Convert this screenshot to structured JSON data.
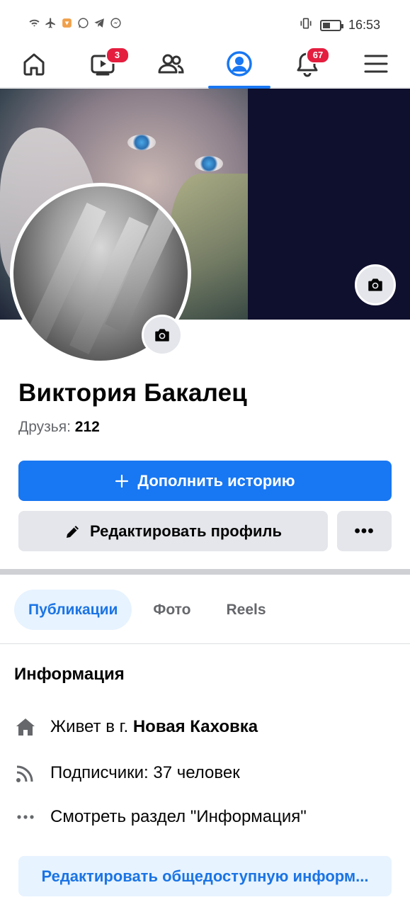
{
  "status_bar": {
    "time": "16:53",
    "left_icons": [
      "wifi-icon",
      "airplane-icon",
      "shield-icon",
      "whatsapp-icon",
      "telegram-icon",
      "messenger-icon"
    ],
    "right_icons": [
      "vibrate-icon",
      "battery-icon"
    ]
  },
  "nav": {
    "items": [
      {
        "name": "home",
        "icon": "home-icon"
      },
      {
        "name": "video",
        "icon": "video-icon",
        "badge": "3"
      },
      {
        "name": "friends",
        "icon": "friends-icon"
      },
      {
        "name": "profile",
        "icon": "profile-icon",
        "active": true
      },
      {
        "name": "notifications",
        "icon": "bell-icon",
        "badge": "67"
      },
      {
        "name": "menu",
        "icon": "menu-icon"
      }
    ]
  },
  "profile": {
    "name": "Виктория Бакалец",
    "friends_label": "Друзья:",
    "friends_count": "212"
  },
  "buttons": {
    "add_story": "Дополнить историю",
    "edit_profile": "Редактировать профиль",
    "more": "•••"
  },
  "tabs": [
    {
      "label": "Публикации",
      "active": true
    },
    {
      "label": "Фото",
      "active": false
    },
    {
      "label": "Reels",
      "active": false
    }
  ],
  "info": {
    "title": "Информация",
    "lives_prefix": "Живет в г.",
    "lives_city": "Новая Каховка",
    "followers": "Подписчики: 37 человек",
    "see_more": "Смотреть раздел \"Информация\"",
    "edit_public": "Редактировать общедоступную информ..."
  },
  "colors": {
    "accent": "#1877f2",
    "badge": "#e41e3f",
    "secondary_bg": "#e4e6eb",
    "tab_active_bg": "#e7f3ff",
    "tab_active_text": "#1b74e4"
  }
}
